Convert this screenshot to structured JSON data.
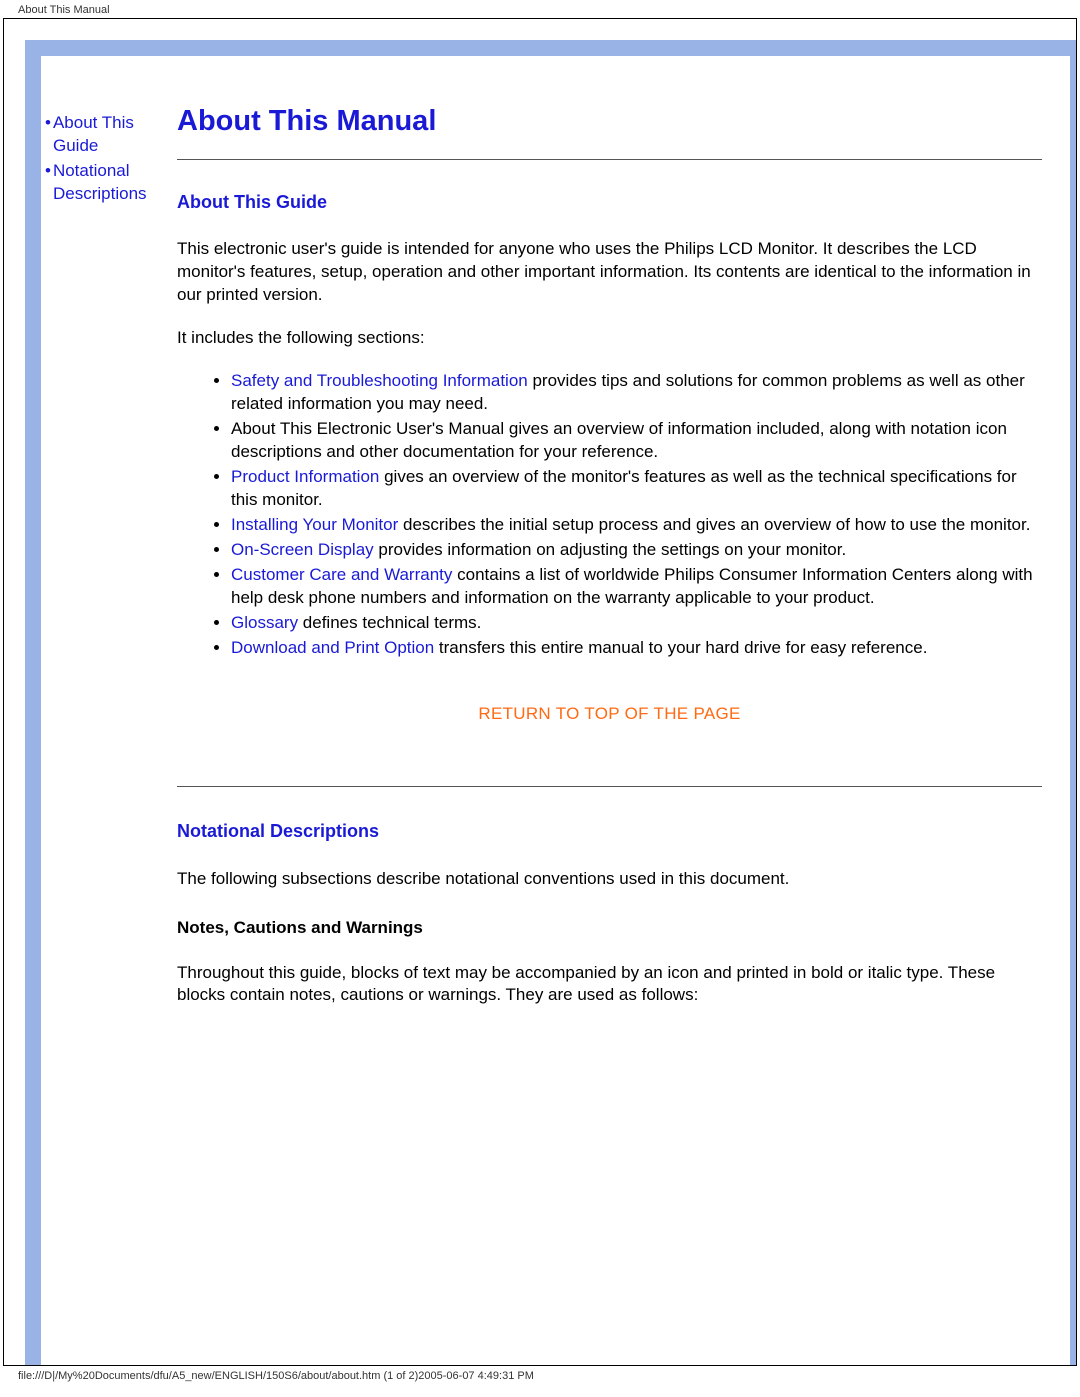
{
  "header": {
    "title": "About This Manual"
  },
  "sidenav": {
    "items": [
      {
        "label": "About This Guide"
      },
      {
        "label": "Notational Descriptions"
      }
    ]
  },
  "main": {
    "title": "About This Manual",
    "section1": {
      "heading": "About This Guide",
      "p1": "This electronic user's guide is intended for anyone who uses the Philips LCD Monitor. It describes the LCD monitor's features, setup, operation and other important information. Its contents are identical to the information in our printed version.",
      "p2": "It includes the following sections:",
      "bullets": {
        "b1_link": "Safety and Troubleshooting Information",
        "b1_rest": " provides tips and solutions for common problems as well as other related information you may need.",
        "b2": "About This Electronic User's Manual gives an overview of information included, along with notation icon descriptions and other documentation for your reference.",
        "b3_link": "Product Information",
        "b3_rest": " gives an overview of the monitor's features as well as the technical specifications for this monitor.",
        "b4_link": "Installing Your Monitor",
        "b4_rest": " describes the initial setup process and gives an overview of how to use the monitor.",
        "b5_link": "On-Screen Display",
        "b5_rest": " provides information on adjusting the settings on your monitor.",
        "b6_link": "Customer Care and Warranty",
        "b6_rest": " contains a list of worldwide Philips Consumer Information Centers along with help desk phone numbers and information on the warranty applicable to your product.",
        "b7_link": "Glossary",
        "b7_rest": " defines technical terms.",
        "b8_link": "Download and Print Option",
        "b8_rest": " transfers this entire manual to your hard drive for easy reference."
      }
    },
    "return_top": "RETURN TO TOP OF THE PAGE",
    "section2": {
      "heading": "Notational Descriptions",
      "p1": "The following subsections describe notational conventions used in this document.",
      "sub_heading": "Notes, Cautions and Warnings",
      "p2": "Throughout this guide, blocks of text may be accompanied by an icon and printed in bold or italic type. These blocks contain notes, cautions or warnings. They are used as follows:"
    }
  },
  "footer": {
    "path": "file:///D|/My%20Documents/dfu/A5_new/ENGLISH/150S6/about/about.htm (1 of 2)2005-06-07 4:49:31 PM"
  }
}
